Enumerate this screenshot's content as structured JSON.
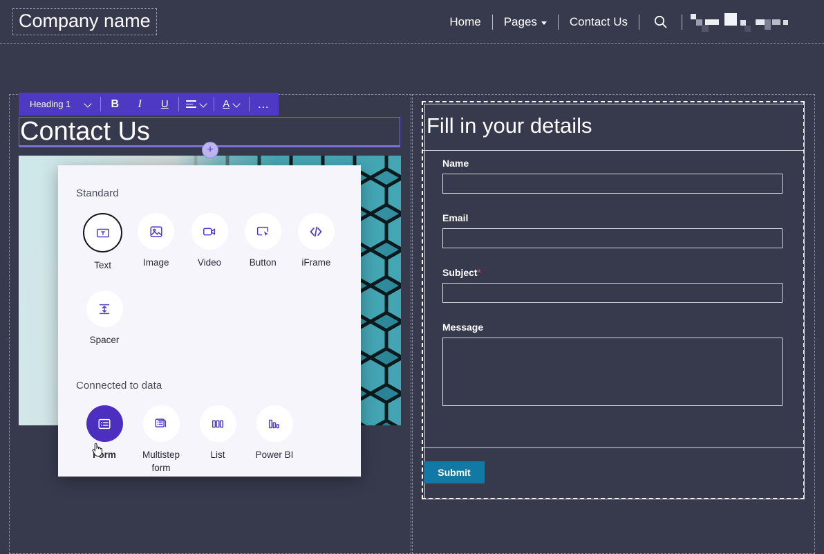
{
  "header": {
    "brand": "Company name",
    "nav": [
      {
        "label": "Home",
        "has_caret": false
      },
      {
        "label": "Pages",
        "has_caret": true
      },
      {
        "label": "Contact Us",
        "has_caret": false
      }
    ],
    "search_icon": "search-icon",
    "redacted_label": ""
  },
  "toolbar": {
    "style_value": "Heading 1",
    "bold": "B",
    "italic": "I",
    "underline": "U",
    "font_color": "A",
    "overflow": "…"
  },
  "editor": {
    "heading_text": "Contact Us",
    "add_handle": "+"
  },
  "insert_panel": {
    "standard_title": "Standard",
    "connected_title": "Connected to data",
    "standard_items": [
      {
        "label": "Text",
        "icon": "text-icon",
        "state": "focused"
      },
      {
        "label": "Image",
        "icon": "image-icon",
        "state": "default"
      },
      {
        "label": "Video",
        "icon": "video-icon",
        "state": "default"
      },
      {
        "label": "Button",
        "icon": "button-icon",
        "state": "default"
      },
      {
        "label": "iFrame",
        "icon": "code-icon",
        "state": "default"
      },
      {
        "label": "Spacer",
        "icon": "spacer-icon",
        "state": "default"
      }
    ],
    "connected_items": [
      {
        "label": "Form",
        "icon": "form-icon",
        "state": "selected"
      },
      {
        "label": "Multistep form",
        "icon": "multistep-icon",
        "state": "default"
      },
      {
        "label": "List",
        "icon": "list-icon",
        "state": "default"
      },
      {
        "label": "Power BI",
        "icon": "powerbi-icon",
        "state": "default"
      }
    ]
  },
  "form": {
    "title": "Fill in your details",
    "fields": [
      {
        "label": "Name",
        "required": false,
        "value": "",
        "type": "text"
      },
      {
        "label": "Email",
        "required": false,
        "value": "",
        "type": "text"
      },
      {
        "label": "Subject",
        "required": true,
        "value": "",
        "type": "text"
      },
      {
        "label": "Message",
        "required": false,
        "value": "",
        "type": "textarea"
      }
    ],
    "required_marker": "*",
    "submit_label": "Submit"
  },
  "colors": {
    "page_bg": "#373a4d",
    "toolbar_purple": "#4d39c4",
    "accent_purple": "#4d2fc0",
    "panel_bg": "#f6f5fb",
    "submit_teal": "#1279a2",
    "required_red": "#d9534f"
  }
}
